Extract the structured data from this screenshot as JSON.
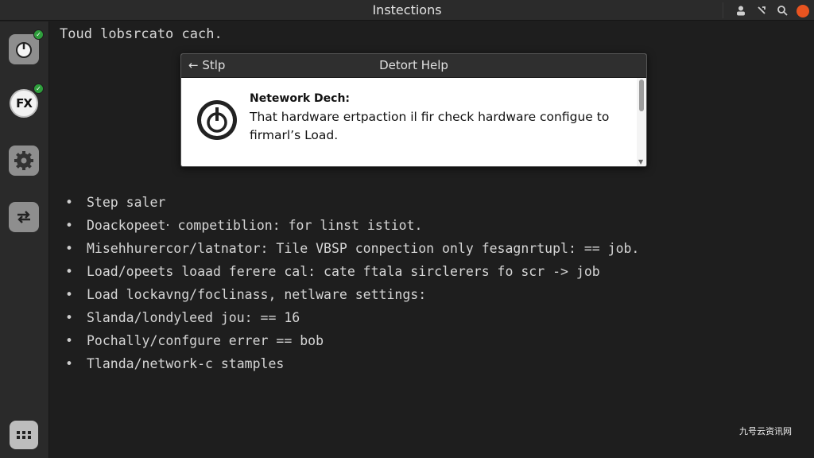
{
  "window": {
    "title": "Instections"
  },
  "dock": {
    "items": [
      {
        "name": "app-icon-power",
        "badge": "✓"
      },
      {
        "name": "app-icon-fx",
        "label": "FX",
        "badge": "✓"
      },
      {
        "name": "app-icon-settings"
      },
      {
        "name": "app-icon-switch"
      },
      {
        "name": "app-grid"
      }
    ]
  },
  "terminal": {
    "first_line": "Toud lobsrcato cach."
  },
  "dialog": {
    "back_label": "← Stlp",
    "title": "Detort Help",
    "heading": "Netework Dech:",
    "body": "That hardware ertpaction il fir check hardware configue to firmarl’s Load."
  },
  "list": {
    "items": [
      "Step saler",
      "Doackopeet‧ competiblion: for linst istiot.",
      "Misehhurercor/latnator: Tile VBSP conpection only fesagnrtupl: == job.",
      "Load/opeets loaad ferere cal: cate ftala sirclerers fo scr -> job",
      "Load lockavng/foclinass, netlware settings:",
      "Slanda/londyleed jou: == 16",
      "Pochally/confgure errer == bob",
      "Tlanda/network-c stamples"
    ],
    "bullet": "•"
  },
  "watermark": "九号云资讯网",
  "colors": {
    "background": "#1e1e1e",
    "titlebar": "#2b2b2b",
    "close": "#e95420",
    "badge": "#2e9e3c"
  }
}
